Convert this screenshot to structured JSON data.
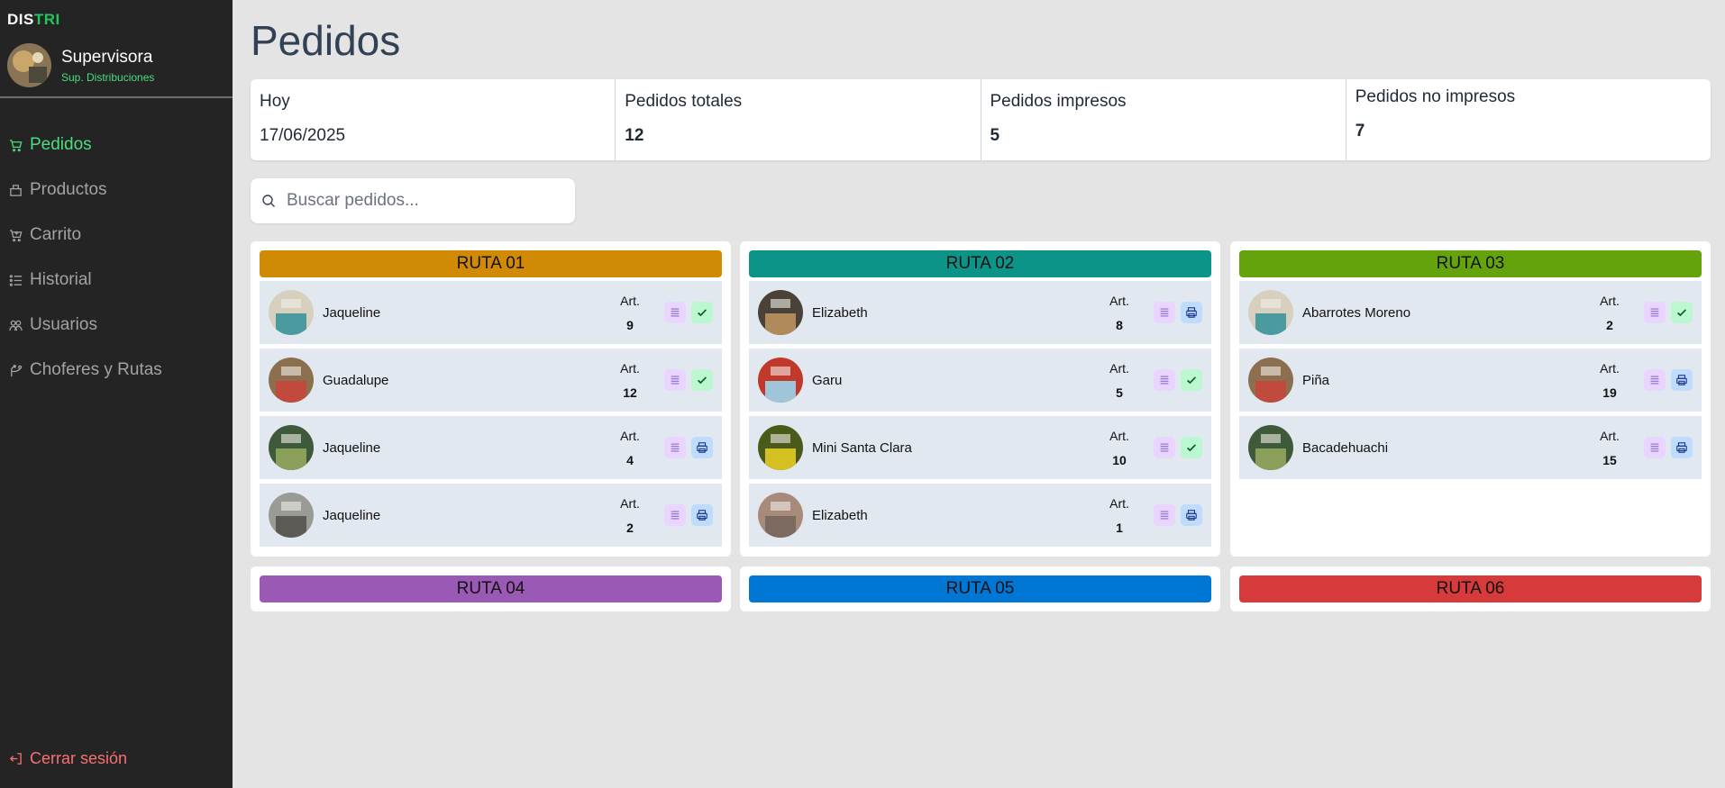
{
  "app": {
    "brand_part1": "DIS",
    "brand_part2": "TRI"
  },
  "user": {
    "name": "Supervisora",
    "role": "Sup. Distribuciones"
  },
  "nav": [
    {
      "label": "Pedidos",
      "icon": "cart-icon",
      "active": true
    },
    {
      "label": "Productos",
      "icon": "box-icon",
      "active": false
    },
    {
      "label": "Carrito",
      "icon": "cart-plus-icon",
      "active": false
    },
    {
      "label": "Historial",
      "icon": "list-icon",
      "active": false
    },
    {
      "label": "Usuarios",
      "icon": "users-icon",
      "active": false
    },
    {
      "label": "Choferes y Rutas",
      "icon": "route-icon",
      "active": false
    }
  ],
  "logout_label": "Cerrar sesión",
  "page_title": "Pedidos",
  "stats": [
    {
      "label": "Hoy",
      "value": "17/06/2025"
    },
    {
      "label": "Pedidos totales",
      "value": "12"
    },
    {
      "label": "Pedidos impresos",
      "value": "5"
    },
    {
      "label": "Pedidos no impresos",
      "value": "7"
    }
  ],
  "search": {
    "placeholder": "Buscar pedidos..."
  },
  "art_label": "Art.",
  "routes": [
    {
      "name": "RUTA 01",
      "color": "#d18a04",
      "orders": [
        {
          "name": "Jaqueline",
          "count": "9",
          "status": "check"
        },
        {
          "name": "Guadalupe",
          "count": "12",
          "status": "check"
        },
        {
          "name": "Jaqueline",
          "count": "4",
          "status": "print"
        },
        {
          "name": "Jaqueline",
          "count": "2",
          "status": "print"
        }
      ]
    },
    {
      "name": "RUTA 02",
      "color": "#0d9488",
      "orders": [
        {
          "name": "Elizabeth",
          "count": "8",
          "status": "print"
        },
        {
          "name": "Garu",
          "count": "5",
          "status": "check"
        },
        {
          "name": "Mini Santa Clara",
          "count": "10",
          "status": "check"
        },
        {
          "name": "Elizabeth",
          "count": "1",
          "status": "print"
        }
      ]
    },
    {
      "name": "RUTA 03",
      "color": "#65a30d",
      "orders": [
        {
          "name": "Abarrotes Moreno",
          "count": "2",
          "status": "check"
        },
        {
          "name": "Piña",
          "count": "19",
          "status": "print"
        },
        {
          "name": "Bacadehuachi",
          "count": "15",
          "status": "print"
        }
      ]
    },
    {
      "name": "RUTA 04",
      "color": "#9b59b6",
      "orders": []
    },
    {
      "name": "RUTA 05",
      "color": "#0077d4",
      "orders": []
    },
    {
      "name": "RUTA 06",
      "color": "#d63a3a",
      "orders": []
    }
  ]
}
